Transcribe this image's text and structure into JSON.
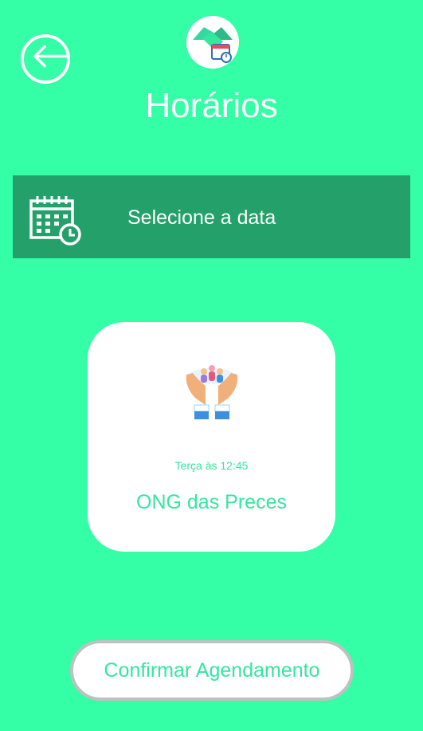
{
  "header": {
    "title": "Horários",
    "back_icon": "arrow-left-circle-icon",
    "logo_icon": "handshake-calendar-icon"
  },
  "date_selector": {
    "label": "Selecione a data",
    "icon": "calendar-clock-icon"
  },
  "appointment": {
    "icon": "hands-holding-people-icon",
    "time": "Terça às 12:45",
    "name": "ONG das Preces"
  },
  "actions": {
    "confirm_label": "Confirmar Agendamento"
  },
  "colors": {
    "background": "#34FFA6",
    "date_bar": "#24A06B",
    "accent_text": "#34E6A0",
    "white": "#FFFFFF"
  }
}
